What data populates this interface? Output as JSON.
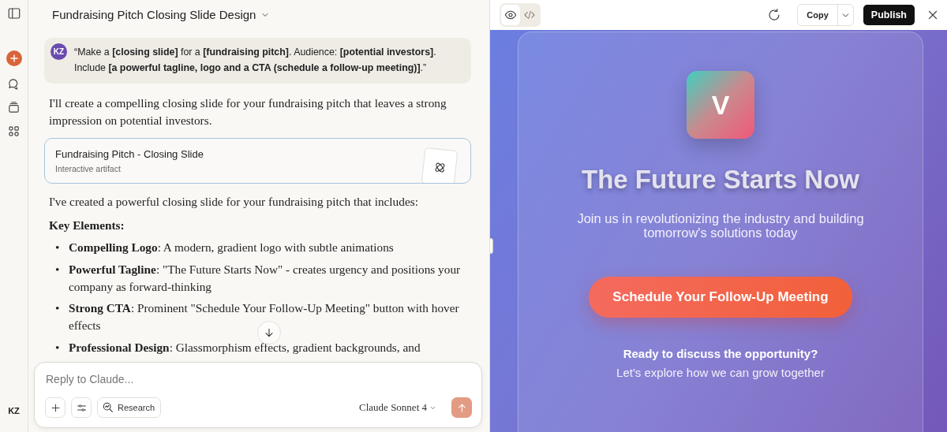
{
  "sidebar": {
    "avatar_initials": "KZ"
  },
  "chat": {
    "title": "Fundraising Pitch Closing Slide Design",
    "user_message": {
      "avatar_initials": "KZ",
      "text": "“Make a **[closing slide]** for a **[fundraising pitch]**. Audience: **[potential investors]**. Include **[a powerful tagline, logo and a CTA (schedule a follow-up meeting)]**.”"
    },
    "intro": "I'll create a compelling closing slide for your fundraising pitch that leaves a strong impression on potential investors.",
    "artifact_card": {
      "title": "Fundraising Pitch - Closing Slide",
      "subtitle": "Interactive artifact"
    },
    "summary": "I've created a powerful closing slide for your fundraising pitch that includes:",
    "heading": "Key Elements:",
    "bullets": [
      {
        "marker": "•",
        "text": "**Compelling Logo**: A modern, gradient logo with subtle animations"
      },
      {
        "marker": "•",
        "text": "**Powerful Tagline**: \"The Future Starts Now\" - creates urgency and positions your company as forward-thinking"
      },
      {
        "marker": "•",
        "text": "**Strong CTA**: Prominent \"Schedule Your Follow-Up Meeting\" button with hover effects"
      },
      {
        "marker": "•",
        "text": "**Professional Design**: Glassmorphism effects, gradient backgrounds, and"
      }
    ],
    "composer": {
      "placeholder": "Reply to Claude...",
      "research_label": "Research",
      "model": "Claude Sonnet 4"
    }
  },
  "artifact": {
    "view_tabs": [
      {
        "kind": "preview",
        "selected": true
      },
      {
        "kind": "code",
        "selected": false
      }
    ],
    "copy_label": "Copy",
    "publish_label": "Publish",
    "slide": {
      "logo_letter": "V",
      "headline": "The Future Starts Now",
      "subheading": "Join us in revolutionizing the industry and building tomorrow's solutions today",
      "cta": "Schedule Your Follow-Up Meeting",
      "closing_question": "Ready to discuss the opportunity?",
      "closing_line": "Let's explore how we can grow together"
    }
  }
}
